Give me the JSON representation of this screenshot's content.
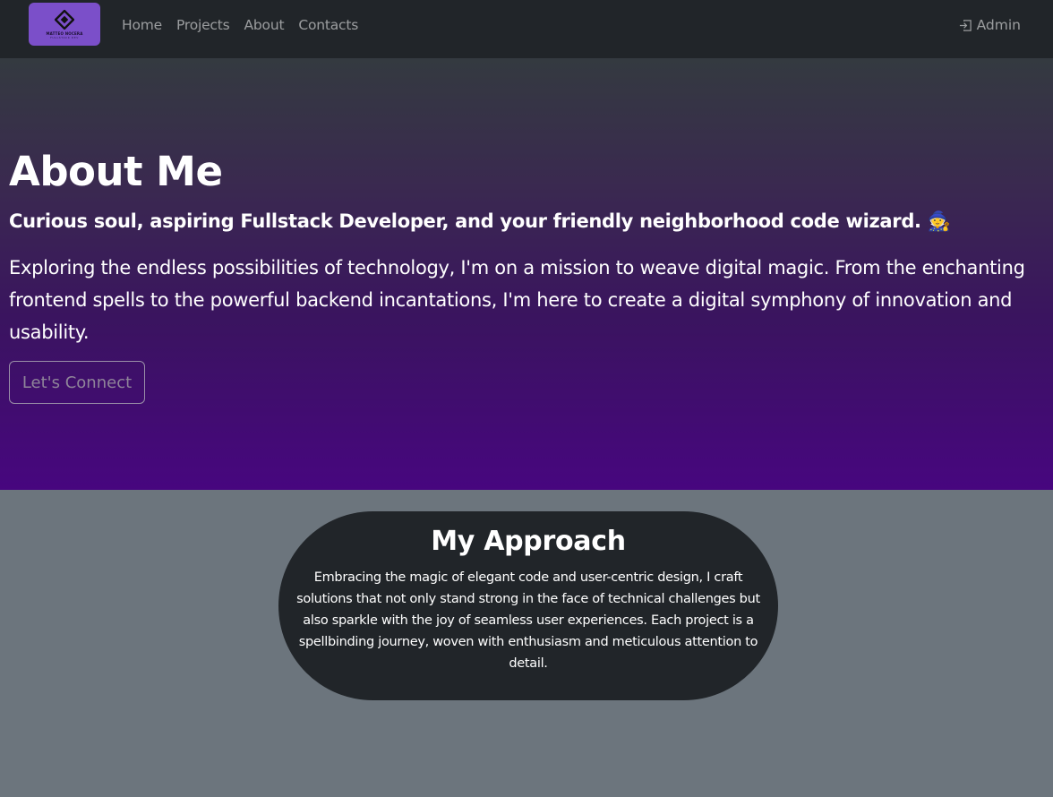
{
  "navbar": {
    "logo": {
      "text": "MATTEO NOCERA",
      "subtext": "FULLSTACK DEV",
      "icon": "diamond-logo-icon"
    },
    "links": [
      "Home",
      "Projects",
      "About",
      "Contacts"
    ],
    "admin": {
      "label": "Admin",
      "icon": "sign-in-icon"
    }
  },
  "hero": {
    "title": "About Me",
    "subtitle": "Curious soul, aspiring Fullstack Developer, and your friendly neighborhood code wizard.",
    "emoji": "🧙",
    "description": "Exploring the endless possibilities of technology, I'm on a mission to weave digital magic. From the enchanting frontend spells to the powerful backend incantations, I'm here to create a digital symphony of innovation and usability.",
    "button": "Let's Connect"
  },
  "approach": {
    "title": "My Approach",
    "text": "Embracing the magic of elegant code and user-centric design, I craft solutions that not only stand strong in the face of technical challenges but also sparkle with the joy of seamless user experiences. Each project is a spellbinding journey, woven with enthusiasm and meticulous attention to detail."
  },
  "colors": {
    "navbar": "#212529",
    "hero_top": "#343a40",
    "hero_bottom": "#47067f",
    "page_bg": "#6c757d",
    "logo_bg": "#7b4fc9"
  }
}
